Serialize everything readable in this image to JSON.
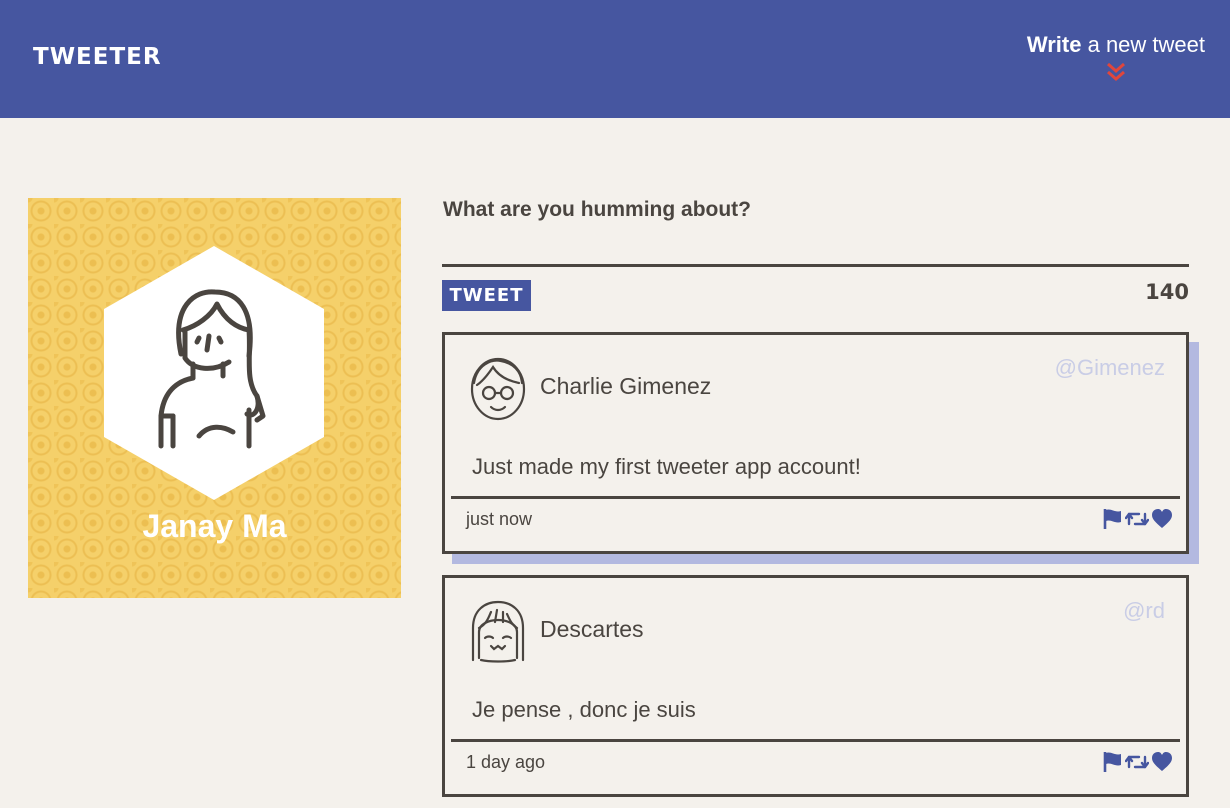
{
  "nav": {
    "brand": "TWEETER",
    "compose_bold": "Write",
    "compose_rest": " a new tweet"
  },
  "profile": {
    "name": "Janay Ma"
  },
  "composer": {
    "prompt": "What are you humming about?",
    "button_label": "TWEET",
    "counter": "140"
  },
  "tweets": [
    {
      "name": "Charlie Gimenez",
      "handle": "@Gimenez",
      "content": "Just made my first tweeter app account!",
      "time": "just now"
    },
    {
      "name": "Descartes",
      "handle": "@rd",
      "content": "Je pense , donc je suis",
      "time": "1 day ago"
    }
  ],
  "icons": {
    "flag": "flag-icon",
    "retweet": "retweet-icon",
    "like": "heart-icon"
  },
  "colors": {
    "nav": "#4656a0",
    "accent_red": "#e0463c",
    "shadow": "#b3b9e0",
    "profile_bg": "#f5d06a"
  }
}
